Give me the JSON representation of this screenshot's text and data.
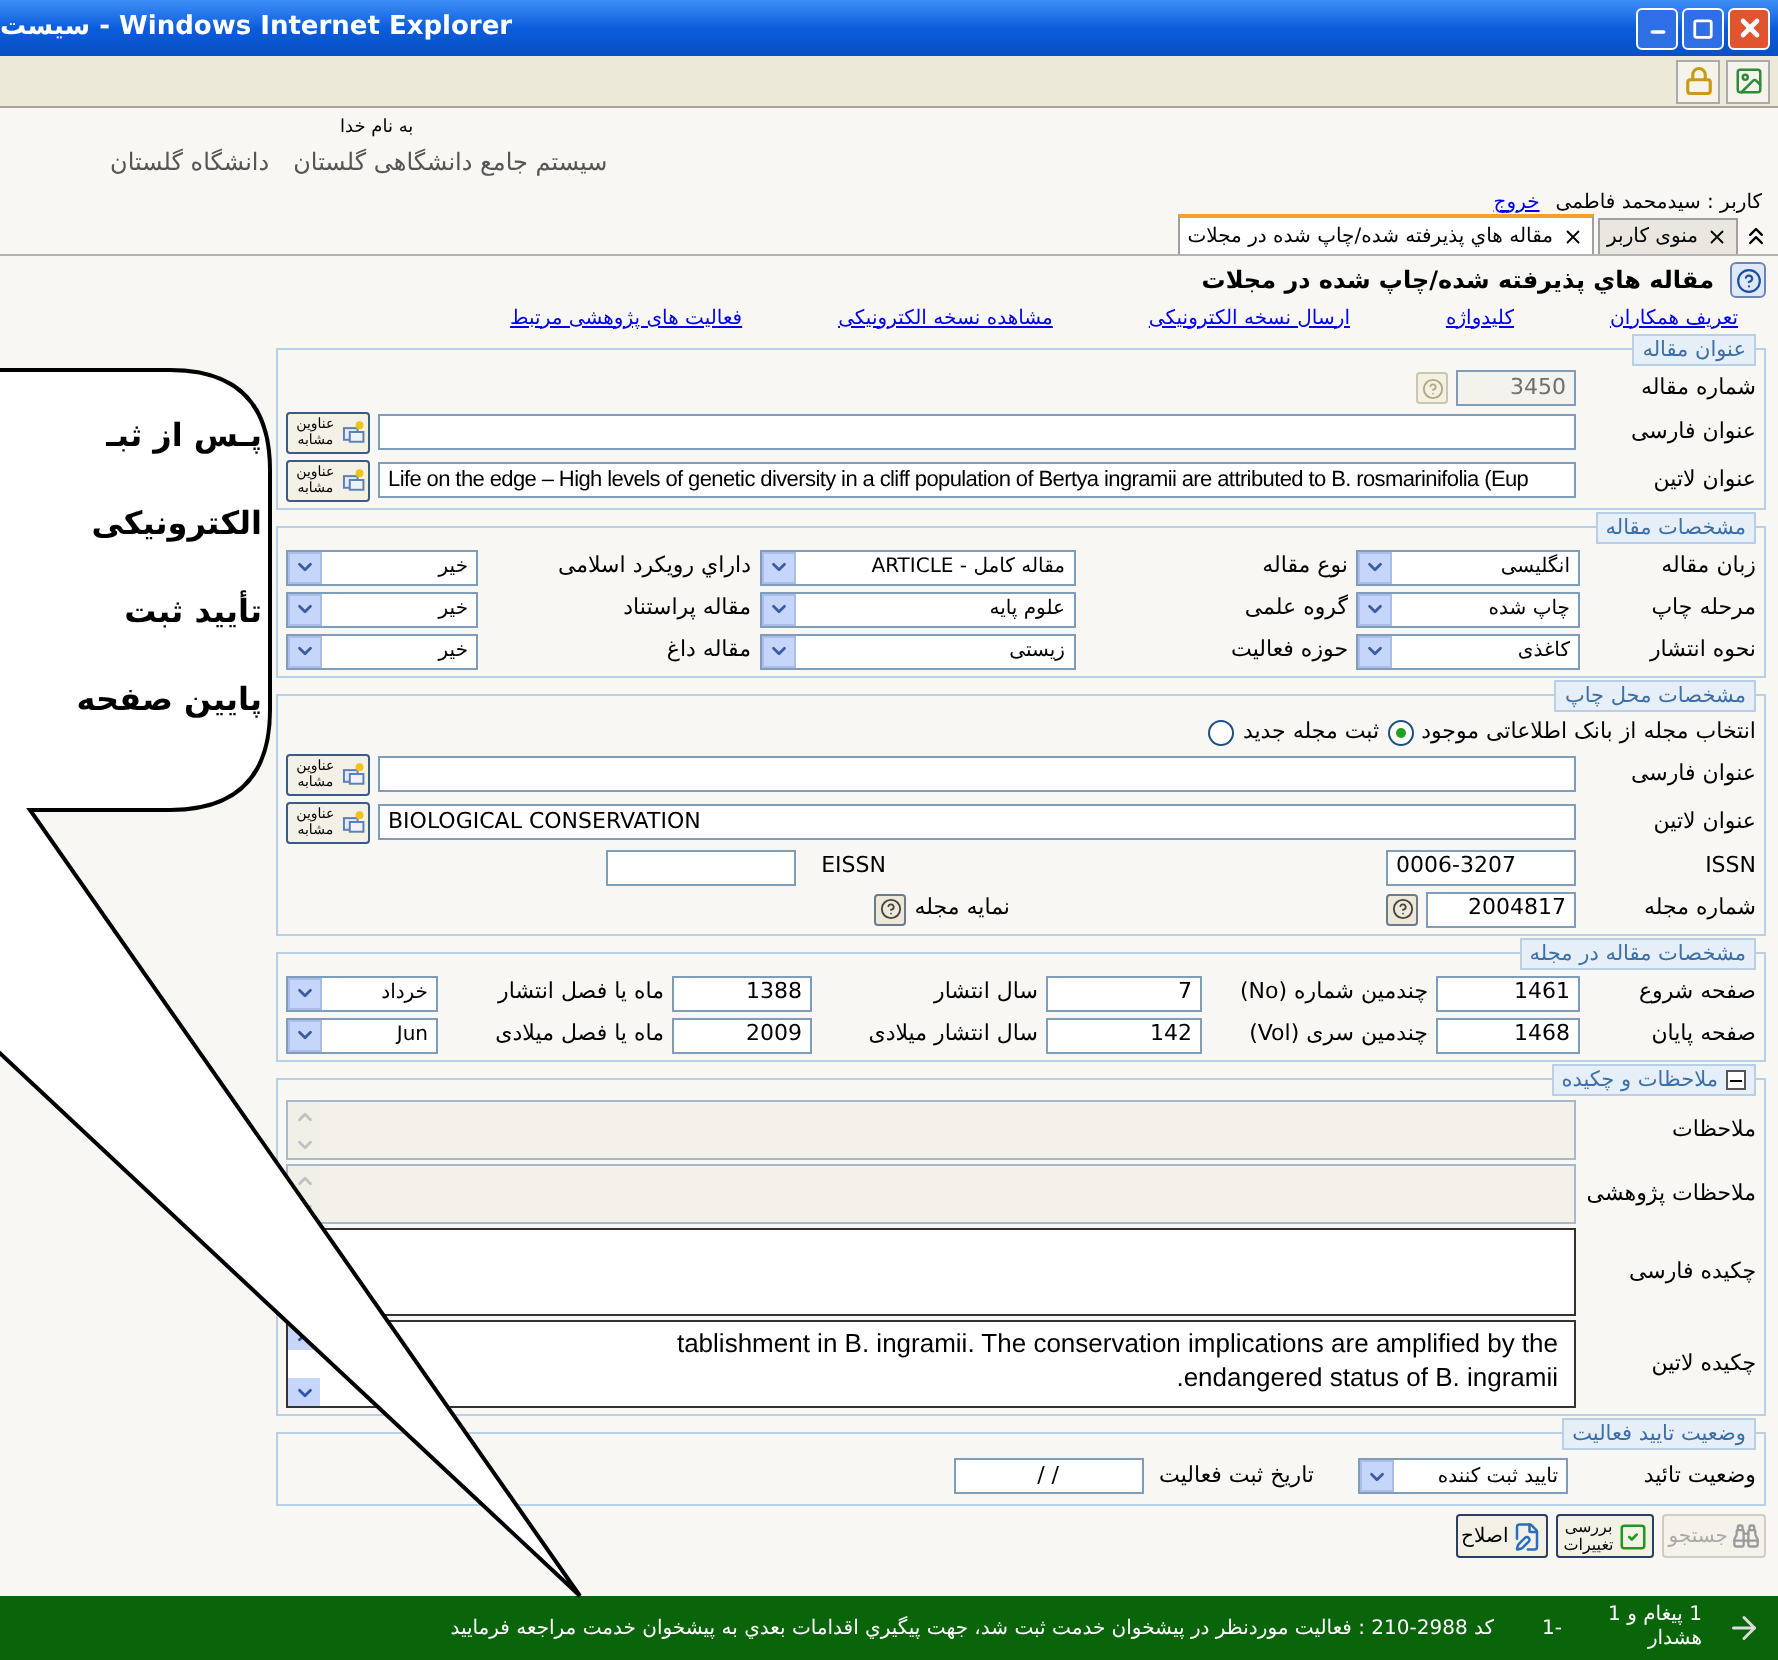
{
  "window": {
    "title": "سیست - Windows Internet Explorer"
  },
  "header": {
    "blessing": "به نام خدا",
    "system_name": "سیستم جامع دانشگاهی گلستان",
    "university": "دانشگاه گلستان"
  },
  "user": {
    "label": "کاربر : سیدمحمد فاطمی",
    "logout": "خروج"
  },
  "tabs": [
    {
      "label": "منوی کاربر",
      "selected": false
    },
    {
      "label": "مقاله هاي پذيرفته شده/چاپ شده در مجلات",
      "selected": true
    }
  ],
  "page_title": "مقاله هاي پذيرفته شده/چاپ شده در مجلات",
  "links": [
    "تعریف همکاران",
    "کلیدواژه",
    "ارسال نسخه الکترونیکی",
    "مشاهده نسخه الکترونیکی",
    "فعالیت های پژوهشی مرتبط"
  ],
  "title_section": {
    "legend": "عنوان مقاله",
    "number": {
      "label": "شماره مقاله",
      "value": "3450",
      "disabled": true
    },
    "persian_title": {
      "label": "عنوان فارسی",
      "button": "عناوین مشابه"
    },
    "latin_title": {
      "label": "عنوان لاتین",
      "value": "Life on the edge – High levels of genetic diversity in a cliff population of Bertya ingramii are attributed to B. rosmarinifolia (Eup",
      "button": "عناوین مشابه"
    }
  },
  "spec_section": {
    "legend": "مشخصات مقاله",
    "rows": [
      [
        {
          "label": "زبان مقاله",
          "value": "انگلیسی"
        },
        {
          "label": "نوع مقاله",
          "value": "مقاله کامل - ARTICLE"
        },
        {
          "label": "داراي رویکرد اسلامی",
          "value": "خیر"
        }
      ],
      [
        {
          "label": "مرحله چاپ",
          "value": "چاپ شده"
        },
        {
          "label": "گروه علمی",
          "value": "علوم پایه"
        },
        {
          "label": "مقاله پراستناد",
          "value": "خیر"
        }
      ],
      [
        {
          "label": "نحوه انتشار",
          "value": "کاغذی"
        },
        {
          "label": "حوزه فعالیت",
          "value": "زیستی"
        },
        {
          "label": "مقاله داغ",
          "value": "خیر"
        }
      ]
    ]
  },
  "source_section": {
    "legend": "مشخصات محل چاپ",
    "options": [
      {
        "label": "انتخاب مجله از بانک اطلاعاتی موجود",
        "selected": true
      },
      {
        "label": "ثبت مجله جدید",
        "selected": false
      }
    ],
    "persian_title": {
      "label": "عنوان فارسی",
      "button": "عناوین مشابه"
    },
    "latin_title": {
      "label": "عنوان لاتین",
      "value": "BIOLOGICAL CONSERVATION",
      "button": "عناوین مشابه"
    },
    "issn": {
      "label": "ISSN",
      "value": "0006-3207"
    },
    "eissn": {
      "label": "EISSN"
    },
    "journal_number": {
      "label": "شماره مجله",
      "value": "2004817"
    },
    "journal_index": {
      "label": "نمایه مجله"
    }
  },
  "issue_section": {
    "legend": "مشخصات مقاله در مجله",
    "rows": [
      [
        {
          "kind": "input",
          "label": "صفحه شروع",
          "value": "1461"
        },
        {
          "kind": "input",
          "label": "چندمین شماره (No)",
          "value": "7"
        },
        {
          "kind": "input",
          "label": "سال انتشار",
          "value": "1388"
        },
        {
          "kind": "select",
          "label": "ماه یا فصل انتشار",
          "value": "خرداد"
        }
      ],
      [
        {
          "kind": "input",
          "label": "صفحه پایان",
          "value": "1468"
        },
        {
          "kind": "input",
          "label": "چندمین سری (Vol)",
          "value": "142"
        },
        {
          "kind": "input",
          "label": "سال انتشار میلادی",
          "value": "2009"
        },
        {
          "kind": "select",
          "label": "ماه یا فصل میلادی",
          "value": "Jun"
        }
      ]
    ]
  },
  "notes_section": {
    "legend": "ملاحظات و چکیده",
    "expanded": true,
    "fields": [
      {
        "label": "ملاحظات",
        "disabled": true,
        "kind": "short"
      },
      {
        "label": "ملاحظات پژوهشی",
        "disabled": true,
        "kind": "short"
      },
      {
        "label": "چکیده فارسی",
        "disabled": false,
        "kind": "tall"
      },
      {
        "label": "چکیده لاتین",
        "disabled": false,
        "kind": "tall",
        "value": "tablishment in B. ingramii. The conservation implications are amplified by the\nendangered status of B. ingramii."
      }
    ]
  },
  "approval_section": {
    "legend": "وضعیت تایید فعالیت",
    "status": {
      "label": "وضعیت تائید",
      "value": "تایید ثبت کننده"
    },
    "date": {
      "label": "تاریخ ثبت فعالیت",
      "value": "/       /"
    }
  },
  "buttons": [
    {
      "kind": "search",
      "label": "جستجو",
      "disabled": true
    },
    {
      "kind": "review",
      "label": "بررسی تغییرات",
      "disabled": false
    },
    {
      "kind": "edit",
      "label": "اصلاح",
      "disabled": false
    }
  ],
  "status_bar": {
    "messages": "1 پیغام و 1 هشدار",
    "index": "-1",
    "text": "کد 2988-210 : فعالیت موردنظر در پیشخوان خدمت ثبت شد، جهت پیگیري اقدامات بعدي به پیشخوان خدمت مراجعه فرمایید"
  },
  "callout": {
    "lines": [
      "پـس از ثبـ",
      "الکترونیکی",
      "تأیید ثبت",
      "پایین صفحه"
    ]
  }
}
